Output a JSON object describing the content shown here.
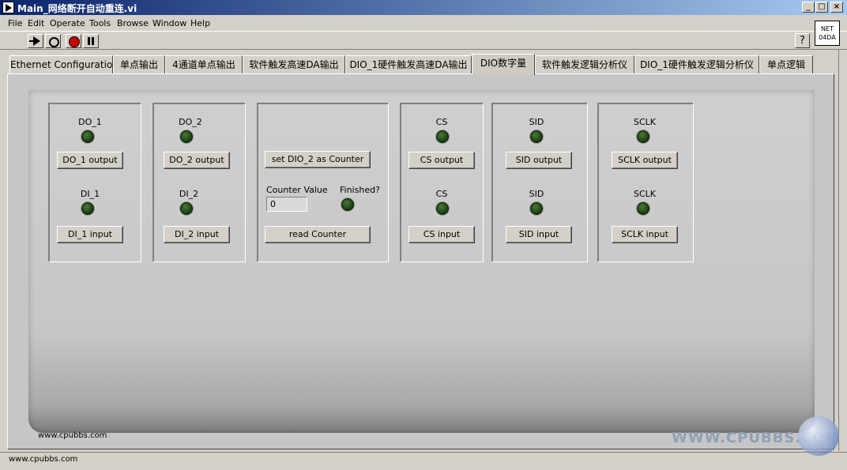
{
  "window": {
    "title": "Main_网络断开自动重连.vi",
    "buttons": [
      "_",
      "□",
      "×"
    ]
  },
  "menu": [
    "File",
    "Edit",
    "Operate",
    "Tools",
    "Browse",
    "Window",
    "Help"
  ],
  "toolbar": {
    "help_label": "?"
  },
  "net_icon": {
    "line1": "NET",
    "line2": "04DA"
  },
  "tabs": [
    "Ethernet Configuration",
    "单点输出",
    "4通道单点输出",
    "软件触发高速DA输出",
    "DIO_1硬件触发高速DA输出",
    "DIO数字量",
    "软件触发逻辑分析仪",
    "DIO_1硬件触发逻辑分析仪",
    "单点逻辑"
  ],
  "active_tab": "DIO数字量",
  "groups": {
    "do1": {
      "out_label": "DO_1",
      "out_button": "DO_1 output",
      "in_label": "DI_1",
      "in_button": "DI_1 input"
    },
    "do2": {
      "out_label": "DO_2",
      "out_button": "DO_2 output",
      "in_label": "DI_2",
      "in_button": "DI_2 input"
    },
    "counter": {
      "set_button": "set DIO_2 as Counter",
      "value_label": "Counter Value",
      "value": "0",
      "finished_label": "Finished?",
      "read_button": "read Counter"
    },
    "cs": {
      "out_label": "CS",
      "out_button": "CS output",
      "in_label": "CS",
      "in_button": "CS input"
    },
    "sid": {
      "out_label": "SID",
      "out_button": "SID output",
      "in_label": "SID",
      "in_button": "SID input"
    },
    "sclk": {
      "out_label": "SCLK",
      "out_button": "SCLK output",
      "in_label": "SCLK",
      "in_button": "SCLK input"
    }
  },
  "panel_credit": "www.cpubbs.com",
  "status": "www.cpubbs.com",
  "watermark": "WWW.CPUBBS.COM"
}
